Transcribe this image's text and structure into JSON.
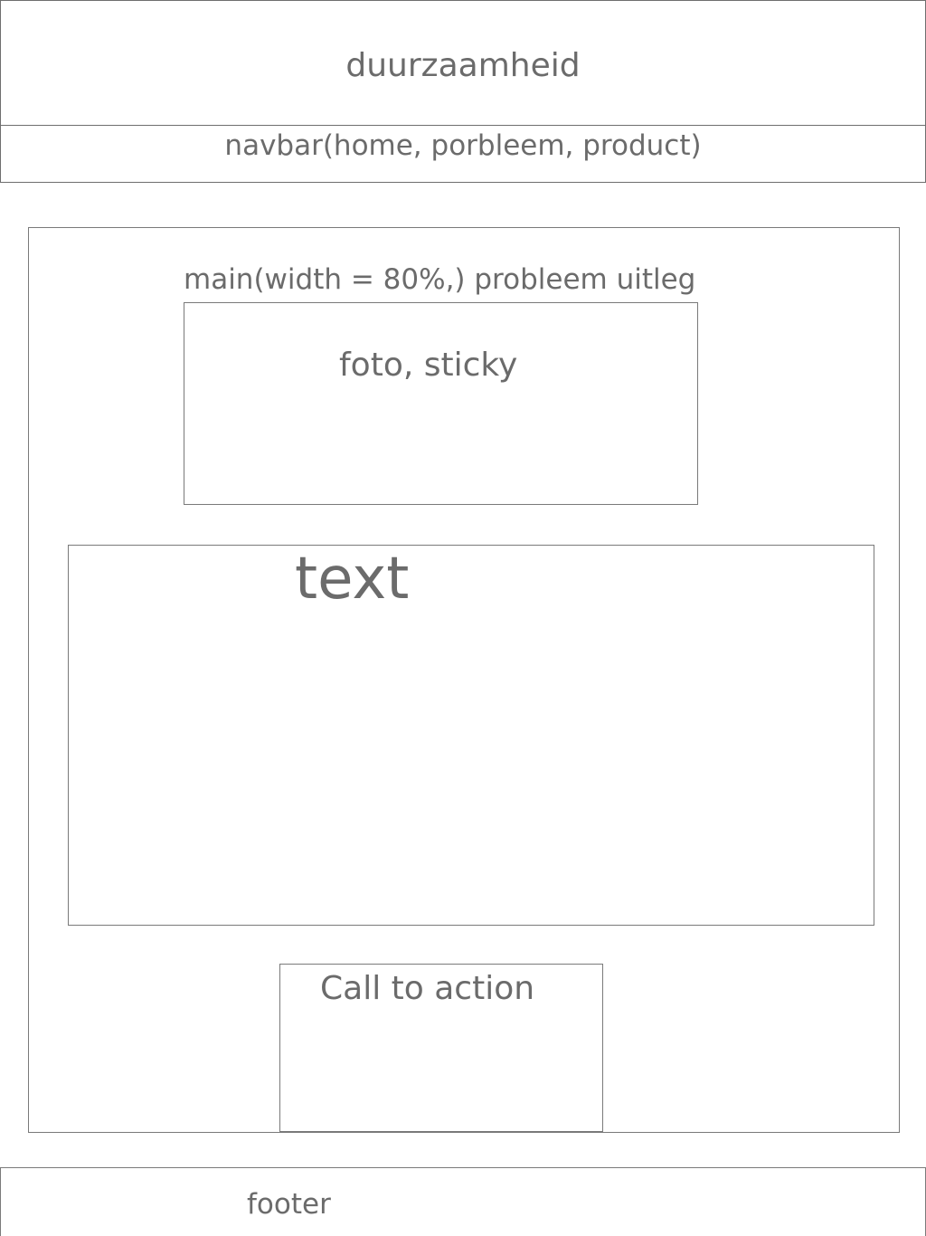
{
  "header": {
    "title": "duurzaamheid"
  },
  "navbar": {
    "label": "navbar(home, porbleem, product)"
  },
  "main": {
    "label": "main(width = 80%,) probleem uitleg",
    "photo": {
      "label": "foto, sticky"
    },
    "text": {
      "label": "text"
    },
    "cta": {
      "label": "Call to action"
    }
  },
  "footer": {
    "label": "footer"
  }
}
